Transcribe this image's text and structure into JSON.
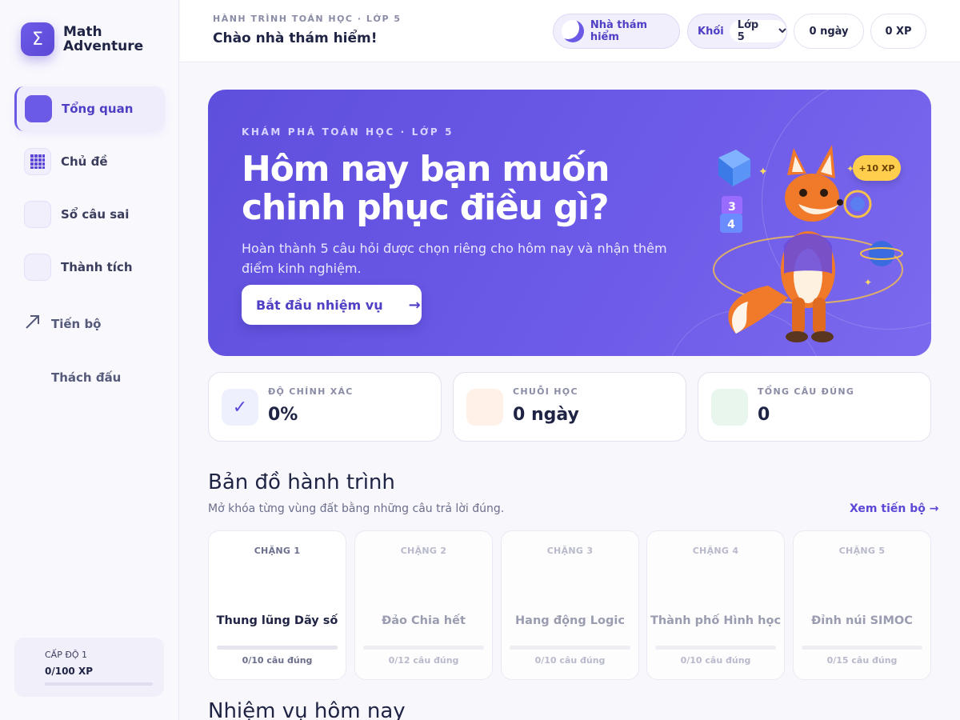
{
  "brand": {
    "logo_symbol": "Σ",
    "name": "Math Adventure"
  },
  "sidebar": {
    "items": [
      {
        "label": "Tổng quan",
        "icon": "home-icon",
        "active": true
      },
      {
        "label": "Chủ đề",
        "icon": "grid-icon",
        "active": false
      },
      {
        "label": "Sổ câu sai",
        "icon": "notebook-icon",
        "active": false
      },
      {
        "label": "Thành tích",
        "icon": "trophy-icon",
        "active": false
      },
      {
        "label": "Tiến bộ",
        "icon": "arrow-up-right-icon",
        "active": false
      },
      {
        "label": "Thách đấu",
        "icon": "sword-icon",
        "active": false
      }
    ],
    "level": {
      "title": "CẤP ĐỘ 1",
      "xp": "0/100 XP",
      "progress": 0
    }
  },
  "topbar": {
    "kicker": "HÀNH TRÌNH TOÁN HỌC · LỚP 5",
    "greeting": "Chào nhà thám hiểm!",
    "theme_label": "Nhà thám hiểm",
    "grade_label": "Khối",
    "grade_value": "Lớp 5",
    "streak": "0 ngày",
    "xp": "0 XP"
  },
  "hero": {
    "kicker": "KHÁM PHÁ TOÁN HỌC · LỚP 5",
    "title": "Hôm nay bạn muốn chinh phục điều gì?",
    "subtitle": "Hoàn thành 5 câu hỏi được chọn riêng cho hôm nay và nhận thêm điểm kinh nghiệm.",
    "button_label": "Bắt đầu nhiệm vụ",
    "button_arrow": "→",
    "badge": "+10 XP",
    "dice_top": "3",
    "dice_bottom": "4"
  },
  "stats": [
    {
      "label": "ĐỘ CHÍNH XÁC",
      "value": "0%",
      "icon": "check-icon",
      "color": "#eef0fd"
    },
    {
      "label": "CHUỖI HỌC",
      "value": "0 ngày",
      "icon": "flame-icon",
      "color": "#fff1e8"
    },
    {
      "label": "TỔNG CÂU ĐÚNG",
      "value": "0",
      "icon": "target-icon",
      "color": "#e8f6ee"
    }
  ],
  "journey": {
    "title": "Bản đồ hành trình",
    "subtitle": "Mở khóa từng vùng đất bằng những câu trả lời đúng.",
    "link": "Xem tiến bộ →",
    "stages": [
      {
        "num": "CHẶNG 1",
        "name": "Thung lũng Dãy số",
        "progress": "0/10 câu đúng",
        "locked": false
      },
      {
        "num": "CHẶNG 2",
        "name": "Đảo Chia hết",
        "progress": "0/12 câu đúng",
        "locked": true
      },
      {
        "num": "CHẶNG 3",
        "name": "Hang động Logic",
        "progress": "0/10 câu đúng",
        "locked": true
      },
      {
        "num": "CHẶNG 4",
        "name": "Thành phố Hình học",
        "progress": "0/10 câu đúng",
        "locked": true
      },
      {
        "num": "CHẶNG 5",
        "name": "Đỉnh núi SIMOC",
        "progress": "0/15 câu đúng",
        "locked": true
      }
    ]
  },
  "missions": {
    "title": "Nhiệm vụ hôm nay"
  }
}
